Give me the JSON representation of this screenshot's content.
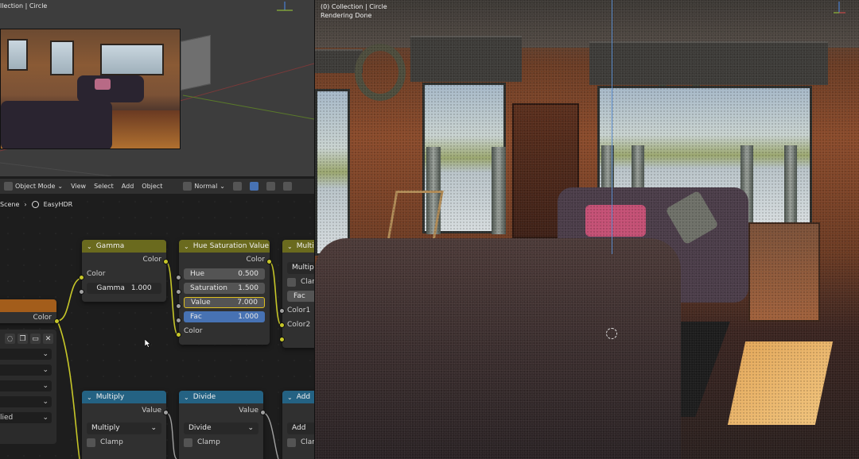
{
  "left_viewport": {
    "label": "llection | Circle"
  },
  "node_editor": {
    "header": {
      "mode": "Object Mode",
      "menus": [
        "View",
        "Select",
        "Add",
        "Object"
      ],
      "orientation": "Normal"
    },
    "breadcrumb": {
      "scene": "Scene",
      "node_group": "EasyHDR"
    },
    "nodes": {
      "gamma": {
        "title": "Gamma",
        "output": "Color",
        "input_color": "Color",
        "gamma_label": "Gamma",
        "gamma_value": "1.000"
      },
      "hue_sat": {
        "title": "Hue Saturation Value",
        "output": "Color",
        "hue_label": "Hue",
        "hue_value": "0.500",
        "sat_label": "Saturation",
        "sat_value": "1.500",
        "value_label": "Value",
        "value_value": "7.000",
        "fac_label": "Fac",
        "fac_value": "1.000",
        "input_color": "Color"
      },
      "multiply_top": {
        "title": "Multi",
        "op": "Multip",
        "clamp": "Clam",
        "fac": "Fac",
        "color1": "Color1",
        "color2": "Color2"
      },
      "group_input": {
        "output": "Color"
      },
      "multiply": {
        "title": "Multiply",
        "output": "Value",
        "op": "Multiply",
        "clamp": "Clamp"
      },
      "divide": {
        "title": "Divide",
        "output": "Value",
        "op": "Divide",
        "clamp": "Clamp"
      },
      "add": {
        "title": "Add",
        "op": "Add",
        "clamp": "Clam"
      }
    },
    "props_panel": {
      "last_row": "lied"
    }
  },
  "render_viewport": {
    "label": "(0) Collection | Circle",
    "status": "Rendering Done"
  },
  "colors": {
    "node_yellow": "#6a6a1e",
    "node_blue": "#246283",
    "node_orange": "#a35d1b",
    "active_field": "#4772b3",
    "socket_yellow": "#c7c729"
  }
}
